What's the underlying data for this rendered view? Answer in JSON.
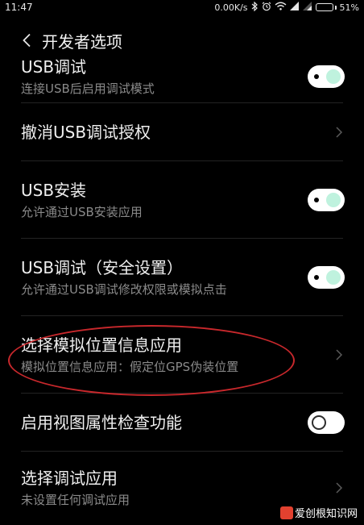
{
  "status": {
    "time": "11:47",
    "network_speed": "0.00K/s",
    "battery_text": "51%",
    "battery_level": 0.51,
    "icons": [
      "bluetooth-icon",
      "alarm-icon",
      "wifi-icon",
      "signal-icon",
      "signal-icon",
      "battery-icon"
    ]
  },
  "header": {
    "title": "开发者选项"
  },
  "items": [
    {
      "title": "USB调试",
      "subtitle": "连接USB后启用调试模式",
      "control": "toggle",
      "on": true
    },
    {
      "title": "撤消USB调试授权",
      "subtitle": "",
      "control": "chevron"
    },
    {
      "title": "USB安装",
      "subtitle": "允许通过USB安装应用",
      "control": "toggle",
      "on": true
    },
    {
      "title": "USB调试（安全设置）",
      "subtitle": "允许通过USB调试修改权限或模拟点击",
      "control": "toggle",
      "on": true
    },
    {
      "title": "选择模拟位置信息应用",
      "subtitle": "模拟位置信息应用：假定位GPS伪装位置",
      "control": "chevron"
    },
    {
      "title": "启用视图属性检查功能",
      "subtitle": "",
      "control": "toggle",
      "on": false
    },
    {
      "title": "选择调试应用",
      "subtitle": "未设置任何调试应用",
      "control": "chevron"
    }
  ],
  "annotation": {
    "color": "#c8282c"
  },
  "watermark": {
    "text": "爱创根知识网"
  },
  "colors": {
    "background": "#000000",
    "toggle_on_knob": "#bff2de",
    "subtitle": "#8a8a8a"
  }
}
